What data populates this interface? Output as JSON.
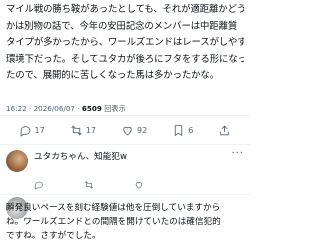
{
  "post": {
    "lines": [
      "マイル戦の勝ち鞍があったとしても、それが適距離かどうか",
      "かは別物の話で、今年の安田記念のメンバーは中距離質",
      "タイプが多かったから、ワールズエンドはレースがしやすい",
      "環境下だった。そしてユタカが後ろにフタをする形になっ",
      "たので、展開的に苦しくなった馬は多かったかな。"
    ],
    "time": "16:22",
    "date": "2026/06/07",
    "views": "6509",
    "views_label": "回表示"
  },
  "actions": {
    "reply_count": "17",
    "retweet_count": "17",
    "like_count": "92",
    "bookmark_count": "6"
  },
  "replies": [
    {
      "lines": [
        "ユタカちゃん、知能犯w"
      ]
    },
    {
      "lines": [
        "瞬発良いペースを刻む経験値は他を圧倒していますから",
        "ね。ワールズエンドとの間隔を開けていたのは確信犯的",
        "ですね。さすがでした。"
      ]
    }
  ],
  "more_label": "···"
}
